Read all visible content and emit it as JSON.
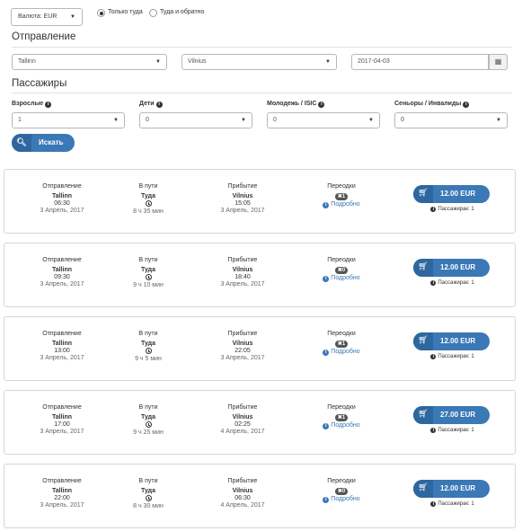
{
  "search": {
    "currency_label": "Валюта: EUR",
    "trip_type": {
      "one_way_label": "Только туда",
      "round_trip_label": "Туда и обратно",
      "selected": "one_way"
    },
    "departure_heading": "Отправление",
    "from_value": "Tallinn",
    "to_value": "Vilnius",
    "date_value": "2017-04-03",
    "passengers_heading": "Пассажиры",
    "adults": {
      "label": "Взрослые",
      "value": "1"
    },
    "children": {
      "label": "Дети",
      "value": "0"
    },
    "youth": {
      "label": "Молодежь / ISIC",
      "value": "0"
    },
    "seniors": {
      "label": "Сеньоры / Инвалиды",
      "value": "0"
    },
    "search_button_label": "Искать"
  },
  "columns": {
    "departure": "Отправление",
    "duration": "В пути",
    "arrival": "Прибытие",
    "transfers": "Переодки",
    "transfers_label": "Переодки"
  },
  "results": [
    {
      "dep_city": "Tallinn",
      "dep_time": "06:30",
      "dep_date": "3 Апрель, 2017",
      "way": "Туда",
      "duration": "8 ч 35 мин",
      "arr_city": "Vilnius",
      "arr_time": "15:05",
      "arr_date": "3 Апрель, 2017",
      "transfers_badge": "✖1",
      "details_label": "Подробно",
      "price": "12.00 EUR",
      "pax_note": "Пассажирак: 1"
    },
    {
      "dep_city": "Tallinn",
      "dep_time": "09:30",
      "dep_date": "3 Апрель, 2017",
      "way": "Туда",
      "duration": "9 ч 10 мин",
      "arr_city": "Vilnius",
      "arr_time": "18:40",
      "arr_date": "3 Апрель, 2017",
      "transfers_badge": "✖0",
      "details_label": "Подробно",
      "price": "12.00 EUR",
      "pax_note": "Пассажирак: 1"
    },
    {
      "dep_city": "Tallinn",
      "dep_time": "13:00",
      "dep_date": "3 Апрель, 2017",
      "way": "Туда",
      "duration": "9 ч 5 мин",
      "arr_city": "Vilnius",
      "arr_time": "22:05",
      "arr_date": "3 Апрель, 2017",
      "transfers_badge": "✖1",
      "details_label": "Подробно",
      "price": "12.00 EUR",
      "pax_note": "Пассажирак: 1"
    },
    {
      "dep_city": "Tallinn",
      "dep_time": "17:00",
      "dep_date": "3 Апрель, 2017",
      "way": "Туда",
      "duration": "9 ч 25 мин",
      "arr_city": "Vilnius",
      "arr_time": "02:25",
      "arr_date": "4 Апрель, 2017",
      "transfers_badge": "✖1",
      "details_label": "Подробно",
      "price": "27.00 EUR",
      "pax_note": "Пассажирак: 1"
    },
    {
      "dep_city": "Tallinn",
      "dep_time": "22:00",
      "dep_date": "3 Апрель, 2017",
      "way": "Туда",
      "duration": "8 ч 30 мин",
      "arr_city": "Vilnius",
      "arr_time": "06:30",
      "arr_date": "4 Апрель, 2017",
      "transfers_badge": "✖0",
      "details_label": "Подробно",
      "price": "12.00 EUR",
      "pax_note": "Пассажирак: 1"
    }
  ],
  "colors": {
    "accent": "#3a78b6",
    "accent_dark": "#2e679f",
    "badge": "#555555"
  }
}
